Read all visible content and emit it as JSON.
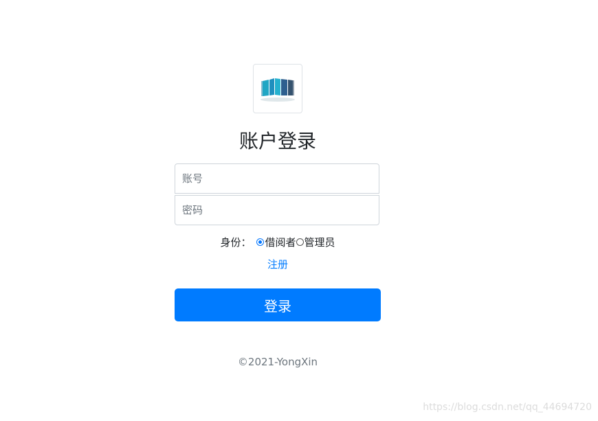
{
  "logo": {
    "icon": "books-icon",
    "colors": [
      "#1f8fbe",
      "#21a6c4",
      "#2d5f8f",
      "#24b1cf"
    ]
  },
  "form": {
    "title": "账户登录",
    "account_placeholder": "账号",
    "password_placeholder": "密码",
    "role_label": "身份：",
    "roles": [
      {
        "label": "借阅者",
        "checked": true
      },
      {
        "label": "管理员",
        "checked": false
      }
    ],
    "register_link": "注册",
    "login_button": "登录"
  },
  "footer": {
    "copyright": "©2021-YongXin"
  },
  "watermark": {
    "text": "https://blog.csdn.net/qq_44694720"
  },
  "theme": {
    "primary": "#007bff",
    "text": "#212529",
    "muted": "#6c757d",
    "border": "#ced4da"
  }
}
